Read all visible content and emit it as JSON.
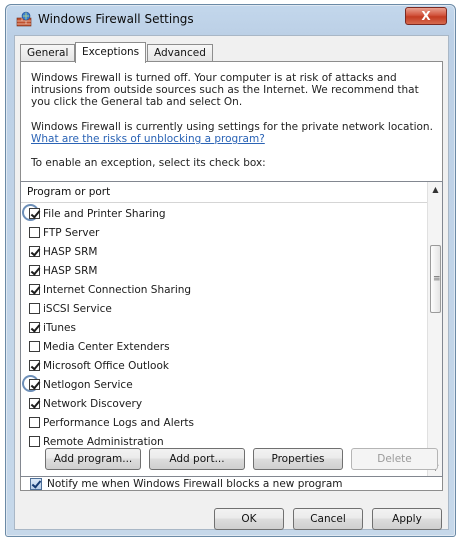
{
  "window": {
    "title": "Windows Firewall Settings",
    "close_label": "X",
    "app_icon": "firewall-icon"
  },
  "tabs": [
    {
      "label": "General",
      "active": false
    },
    {
      "label": "Exceptions",
      "active": true
    },
    {
      "label": "Advanced",
      "active": false
    }
  ],
  "info": {
    "warning": "Windows Firewall is turned off. Your computer is at risk of attacks and intrusions from outside sources such as the Internet. We recommend that you click the General tab and select On.",
    "location": "Windows Firewall is currently using settings for the private network location.",
    "risk_link": "What are the risks of unblocking a program?",
    "instruction": "To enable an exception, select its check box:"
  },
  "list": {
    "header": "Program or port",
    "items": [
      {
        "label": "File and Printer Sharing",
        "checked": true,
        "highlighted": true
      },
      {
        "label": "FTP Server",
        "checked": false,
        "highlighted": false
      },
      {
        "label": "HASP SRM",
        "checked": true,
        "highlighted": false
      },
      {
        "label": "HASP SRM",
        "checked": true,
        "highlighted": false
      },
      {
        "label": "Internet Connection Sharing",
        "checked": true,
        "highlighted": false
      },
      {
        "label": "iSCSI Service",
        "checked": false,
        "highlighted": false
      },
      {
        "label": "iTunes",
        "checked": true,
        "highlighted": false
      },
      {
        "label": "Media Center Extenders",
        "checked": false,
        "highlighted": false
      },
      {
        "label": "Microsoft Office Outlook",
        "checked": true,
        "highlighted": false
      },
      {
        "label": "Netlogon Service",
        "checked": true,
        "highlighted": true
      },
      {
        "label": "Network Discovery",
        "checked": true,
        "highlighted": false
      },
      {
        "label": "Performance Logs and Alerts",
        "checked": false,
        "highlighted": false
      },
      {
        "label": "Remote Administration",
        "checked": false,
        "highlighted": false
      }
    ]
  },
  "buttons": {
    "add_program": "Add program...",
    "add_port": "Add port...",
    "properties": "Properties",
    "delete": "Delete",
    "ok": "OK",
    "cancel": "Cancel",
    "apply": "Apply"
  },
  "notify": {
    "label": "Notify me when Windows Firewall blocks a new program",
    "checked": true
  },
  "colors": {
    "accent": "#6d8fb8",
    "link": "#2a63b5",
    "close": "#c33b22"
  }
}
